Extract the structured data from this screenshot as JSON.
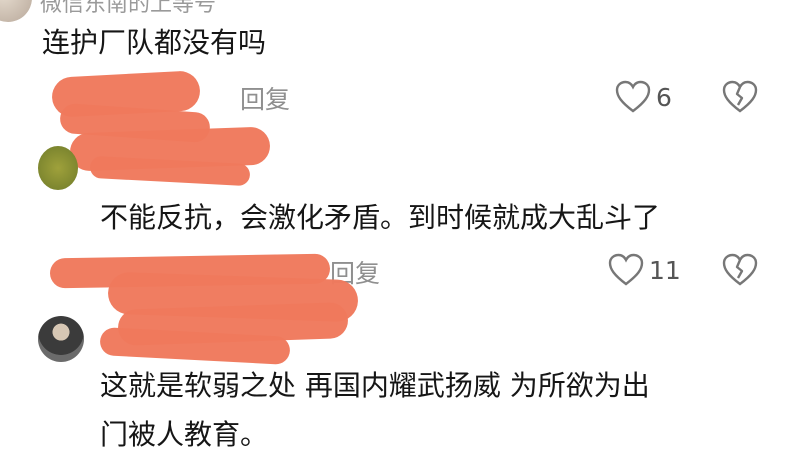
{
  "comment1": {
    "username": "微信东南的上等号",
    "text": "连护厂队都没有吗",
    "reply_label": "回复",
    "like_count": "6"
  },
  "comment2": {
    "text": "不能反抗，会激化矛盾。到时候就成大乱斗了",
    "reply_label": "回复",
    "like_count": "11"
  },
  "comment3": {
    "text_line1": "这就是软弱之处  再国内耀武扬威 为所欲为出",
    "text_line2": "门被人教育。"
  },
  "colors": {
    "redaction": "#f0795c",
    "meta_gray": "#8f8f8f"
  },
  "icons": [
    "heart-outline-icon",
    "broken-heart-icon"
  ]
}
